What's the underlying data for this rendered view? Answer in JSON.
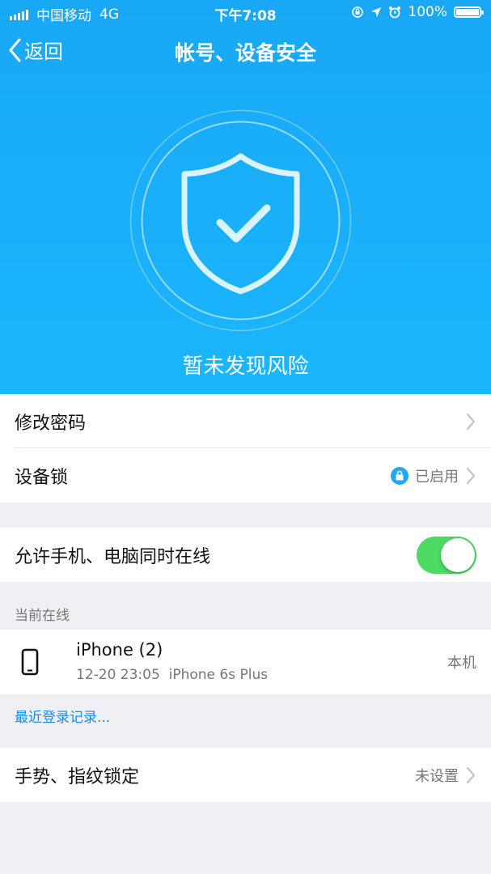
{
  "status_bar": {
    "carrier": "中国移动",
    "network": "4G",
    "time": "下午7:08",
    "battery_percent": "100%",
    "battery_level": 1.0
  },
  "nav": {
    "back_label": "返回",
    "title": "帐号、设备安全"
  },
  "hero": {
    "status_text": "暂未发现风险",
    "icon": "shield-check-icon"
  },
  "security_group": {
    "change_password": "修改密码",
    "device_lock_label": "设备锁",
    "device_lock_status": "已启用"
  },
  "multi_online": {
    "label": "允许手机、电脑同时在线",
    "enabled": true
  },
  "online_section": {
    "header": "当前在线",
    "devices": [
      {
        "name": "iPhone (2)",
        "time": "12-20 23:05",
        "model": "iPhone 6s Plus",
        "tag": "本机",
        "icon": "phone-icon"
      }
    ],
    "recent_login_link": "最近登录记录..."
  },
  "gesture_lock": {
    "label": "手势、指纹锁定",
    "status": "未设置"
  },
  "colors": {
    "hero_blue": "#1ab0f8",
    "toggle_green": "#4cd964",
    "link_blue": "#1a8ee0"
  }
}
